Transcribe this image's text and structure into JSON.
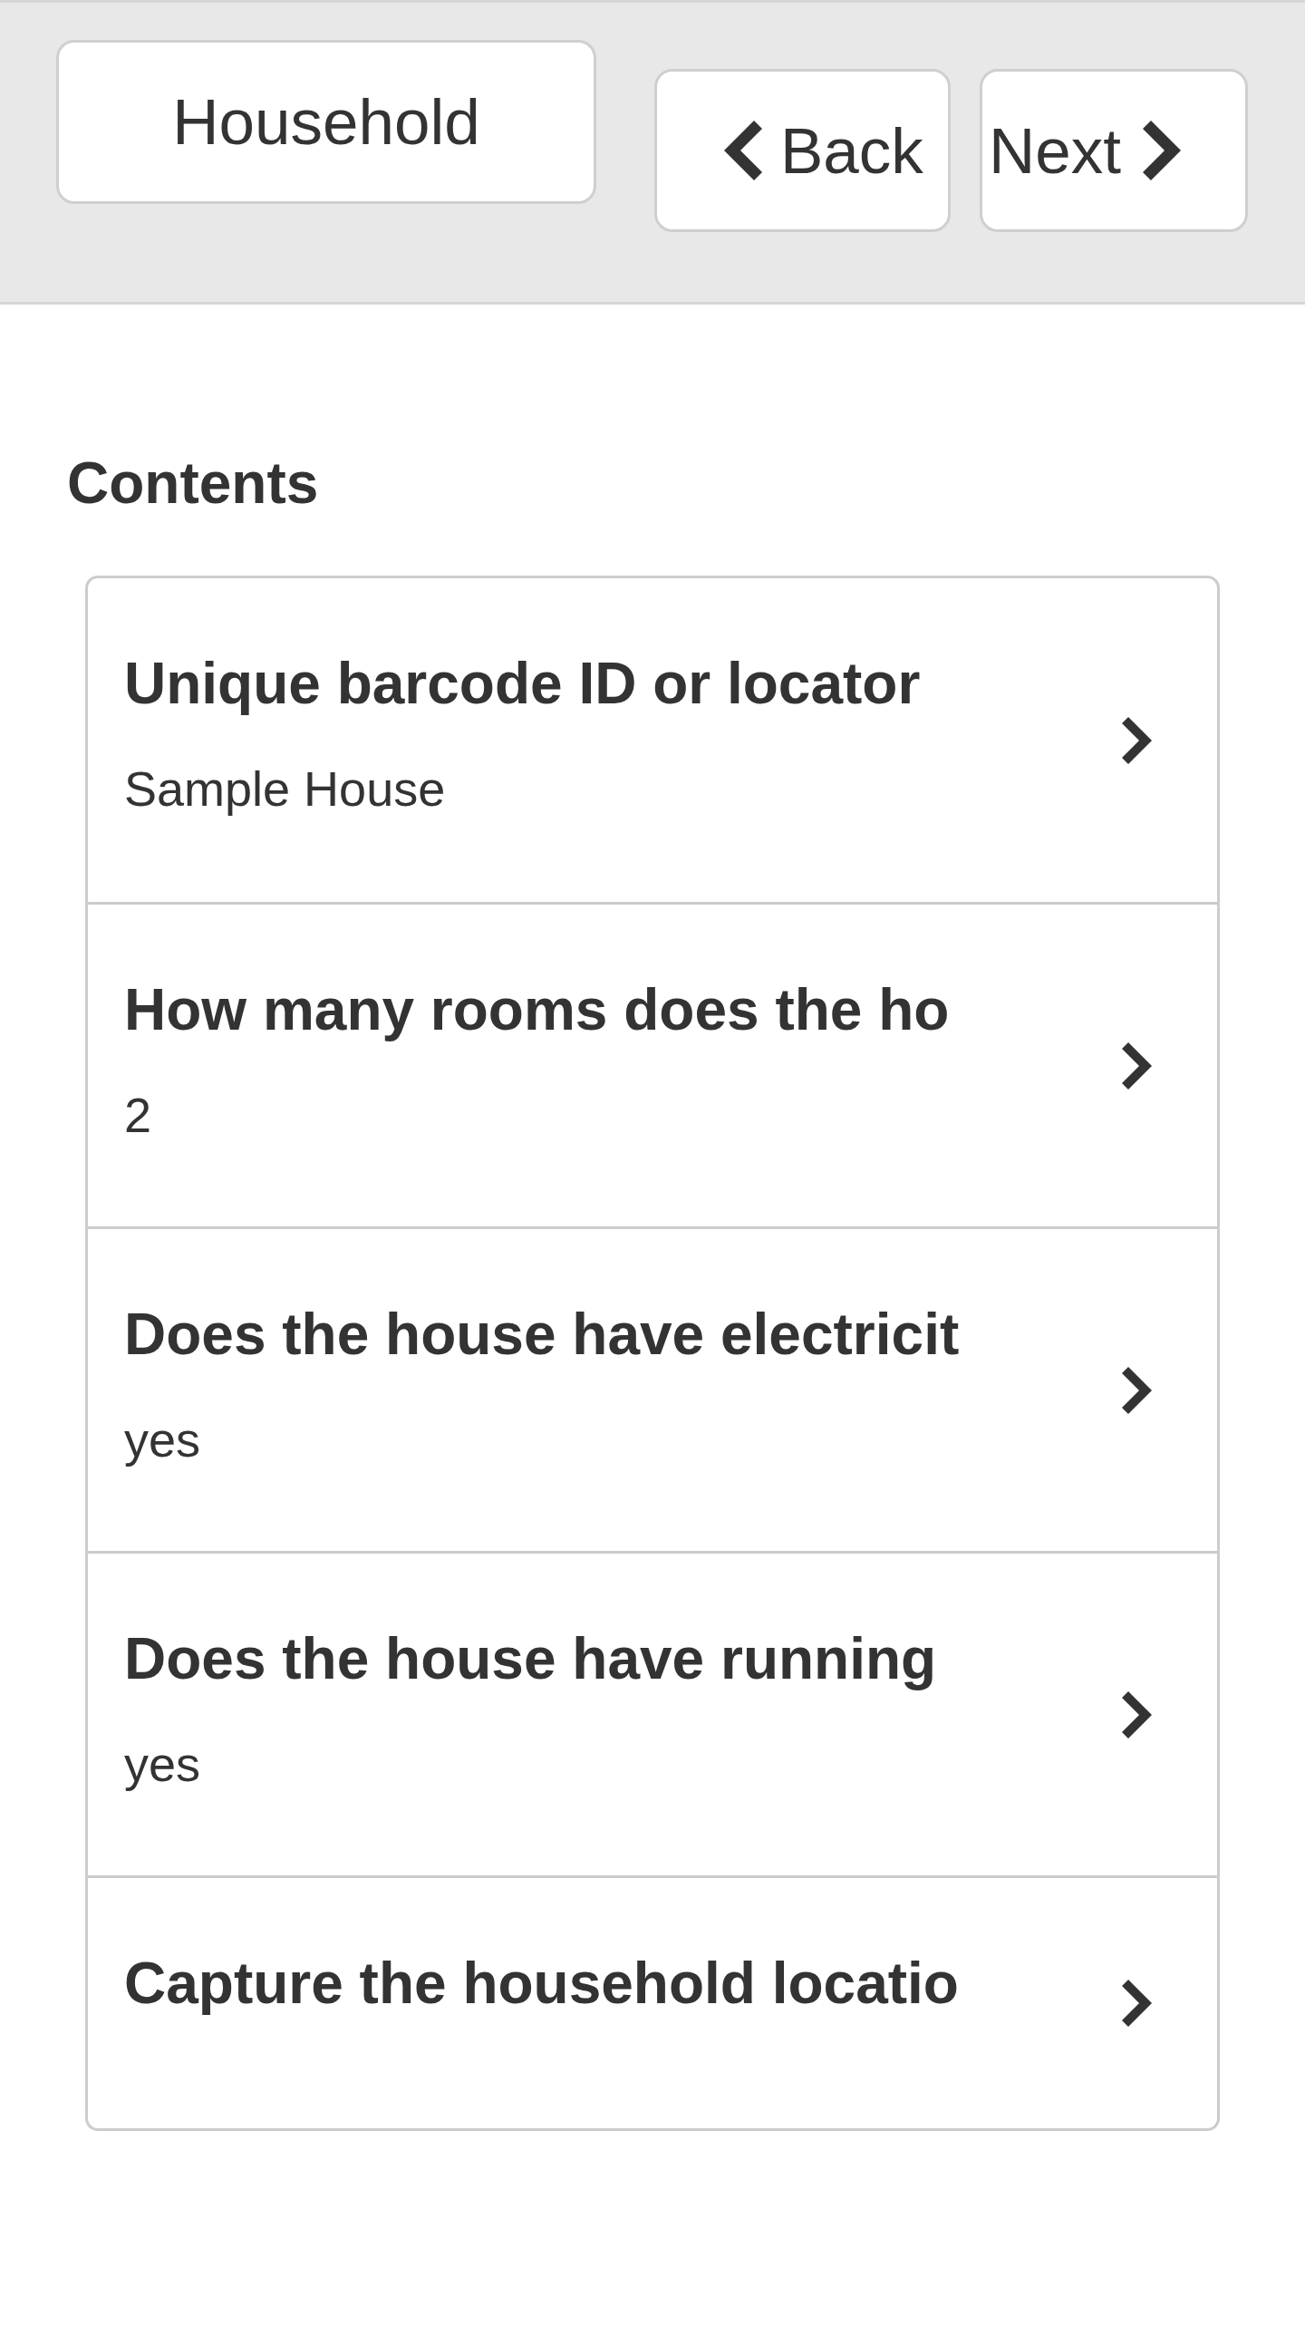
{
  "header": {
    "section_button": "Household",
    "back_button": "Back",
    "next_button": "Next"
  },
  "contents": {
    "title": "Contents",
    "items": [
      {
        "title": "Unique barcode ID or locator",
        "value": "Sample House"
      },
      {
        "title": "How many rooms does the ho",
        "value": "2"
      },
      {
        "title": "Does the house have electricit",
        "value": "yes"
      },
      {
        "title": "Does the house have running",
        "value": "yes"
      },
      {
        "title": "Capture the household locatio"
      }
    ]
  }
}
